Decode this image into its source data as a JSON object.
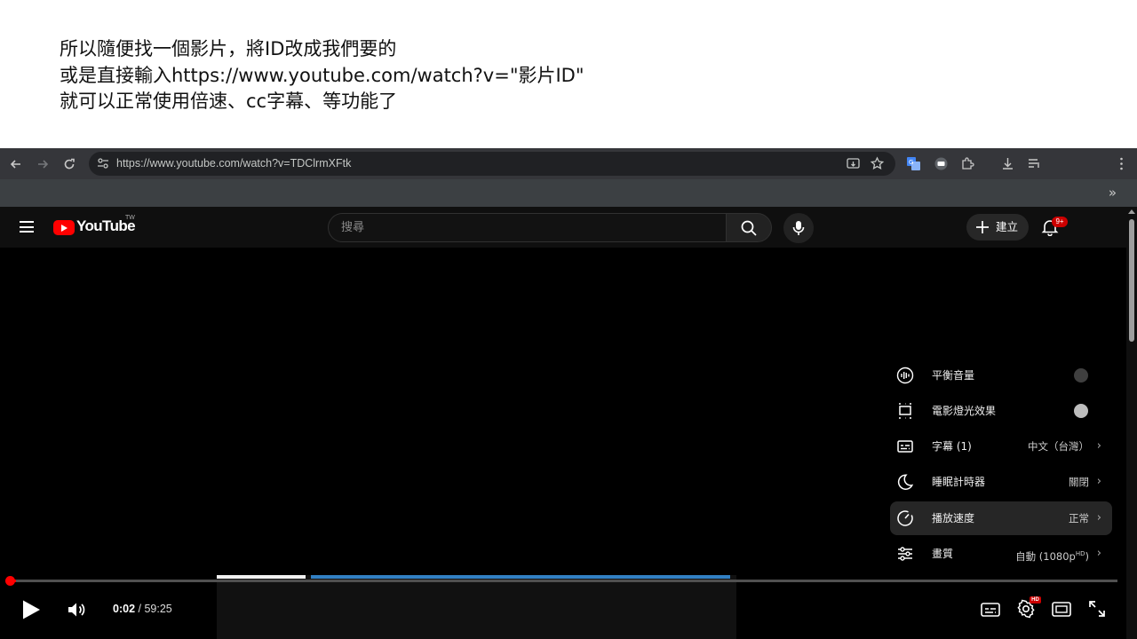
{
  "caption": {
    "line1": "所以隨便找一個影片，將ID改成我們要的",
    "line2": "或是直接輸入https://www.youtube.com/watch?v=\"影片ID\"",
    "line3": "就可以正常使用倍速、cc字幕、等功能了"
  },
  "browser": {
    "url": "https://www.youtube.com/watch?v=TDClrmXFtk",
    "bookmarks_overflow": "»"
  },
  "youtube": {
    "logo_text": "YouTube",
    "region": "TW",
    "search_placeholder": "搜尋",
    "create_label": "建立",
    "notification_count": "9+"
  },
  "player": {
    "current_time": "0:02",
    "separator": " / ",
    "duration": "59:25",
    "progress_fraction": 0.0006,
    "settings_badge": "HD"
  },
  "settings_menu": {
    "items": [
      {
        "label": "平衡音量",
        "type": "toggle",
        "toggle_on": false
      },
      {
        "label": "電影燈光效果",
        "type": "toggle",
        "toggle_on": true
      },
      {
        "label": "字幕 (1)",
        "value": "中文（台灣）",
        "type": "submenu"
      },
      {
        "label": "睡眠計時器",
        "value": "關閉",
        "type": "submenu"
      },
      {
        "label": "播放速度",
        "value": "正常",
        "type": "submenu",
        "active": true
      },
      {
        "label": "畫質",
        "value": "自動 (1080p",
        "value_sup": "HD",
        "value_suffix": ")",
        "type": "submenu"
      }
    ]
  },
  "colors": {
    "yt_red": "#ff0000",
    "toggle_off": "#3f3f3f",
    "toggle_on": "#bdbdbd",
    "storyboard_blue": "#3ea6ff"
  }
}
